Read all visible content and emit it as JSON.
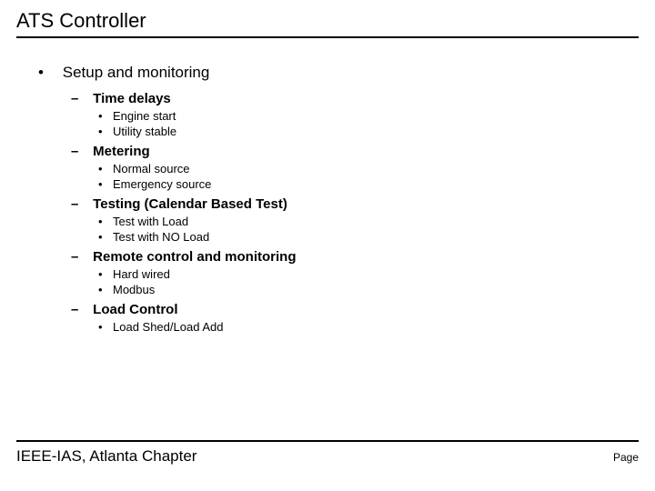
{
  "title": "ATS Controller",
  "content": {
    "heading": "Setup and monitoring",
    "sections": [
      {
        "label": "Time delays",
        "items": [
          "Engine start",
          "Utility stable"
        ]
      },
      {
        "label": "Metering",
        "items": [
          "Normal source",
          "Emergency source"
        ]
      },
      {
        "label": "Testing (Calendar Based Test)",
        "items": [
          "Test with Load",
          "Test with NO Load"
        ]
      },
      {
        "label": "Remote control and monitoring",
        "items": [
          "Hard wired",
          "Modbus"
        ]
      },
      {
        "label": "Load Control",
        "items": [
          "Load Shed/Load Add"
        ]
      }
    ]
  },
  "footer": {
    "left": "IEEE-IAS, Atlanta Chapter",
    "right": "Page"
  }
}
